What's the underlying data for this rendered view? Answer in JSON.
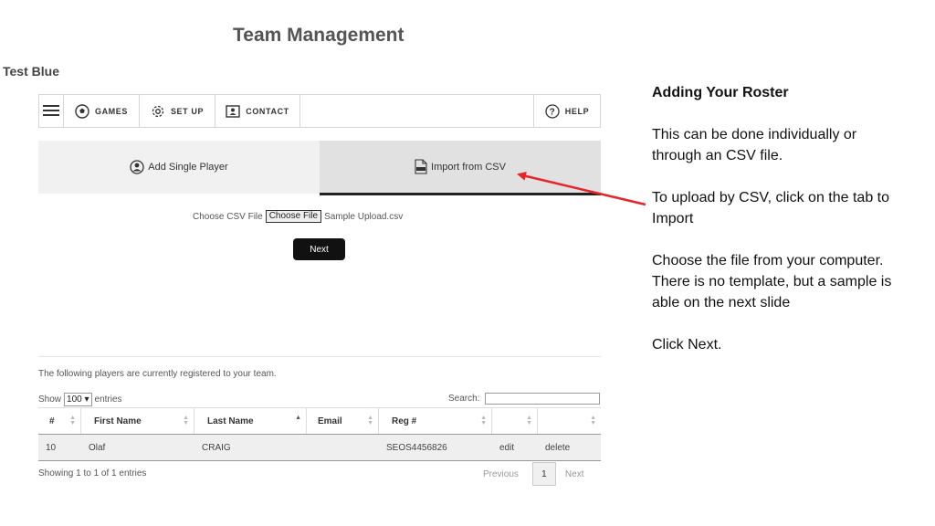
{
  "page_title": "Team Management",
  "team_name": "Test Blue",
  "nav": {
    "games": "GAMES",
    "setup": "SET UP",
    "contact": "CONTACT",
    "help": "HELP"
  },
  "tabs": {
    "single": "Add Single Player",
    "csv": "Import from CSV"
  },
  "upload": {
    "label": "Choose CSV File",
    "button": "Choose File",
    "filename": "Sample Upload.csv",
    "next": "Next"
  },
  "roster": {
    "intro": "The following players are currently registered to your team.",
    "show_prefix": "Show",
    "show_value": "100",
    "show_suffix": "entries",
    "search_label": "Search:",
    "columns": [
      "#",
      "First Name",
      "Last Name",
      "Email",
      "Reg #"
    ],
    "rows": [
      {
        "num": "10",
        "first": "Olaf",
        "last": "CRAIG",
        "email": "",
        "reg": "SEOS4456826",
        "edit": "edit",
        "delete": "delete"
      }
    ],
    "showing": "Showing 1 to 1 of 1 entries",
    "previous": "Previous",
    "page": "1",
    "next": "Next"
  },
  "instructions": {
    "heading": "Adding Your Roster",
    "p1": "This can be done individually or through an CSV file.",
    "p2": "To upload by CSV, click on the tab to Import",
    "p3": "Choose the file from your computer.  There is no template, but a sample is able on the next slide",
    "p4": "Click Next."
  },
  "colors": {
    "arrow": "#e8232a",
    "link": "#2a6bc4",
    "active_tab_border": "#222222"
  }
}
